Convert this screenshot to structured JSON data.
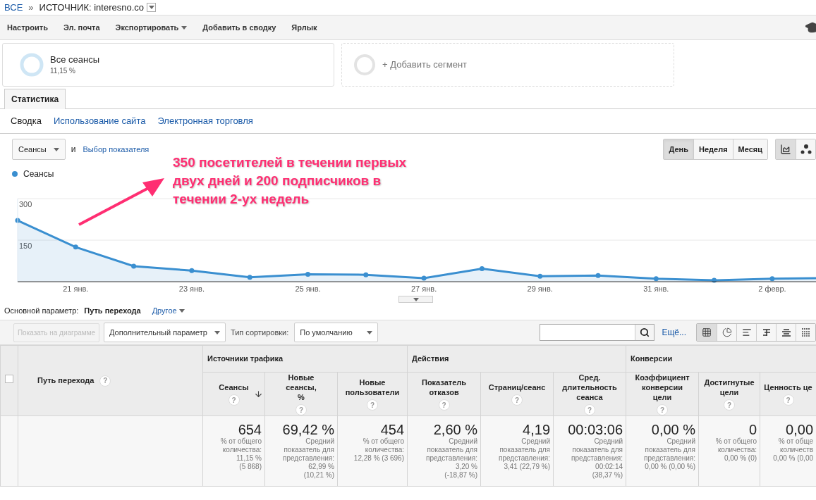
{
  "breadcrumb": {
    "root": "ВСЕ",
    "separator": "»",
    "current": "ИСТОЧНИК: interesno.co"
  },
  "toolbar": [
    "Настроить",
    "Эл. почта",
    "Экспортировать",
    "Добавить в сводку",
    "Ярлык"
  ],
  "segments": [
    {
      "kind": "active",
      "title": "Все сеансы",
      "value": "11,15 %",
      "level": 0.1115
    },
    {
      "kind": "add",
      "title": "+ Добавить сегмент"
    }
  ],
  "tabs": [
    {
      "label": "Статистика",
      "selected": true
    }
  ],
  "subnav": [
    {
      "label": "Сводка",
      "selected": true
    },
    {
      "label": "Использование сайта",
      "selected": false
    },
    {
      "label": "Электронная торговля",
      "selected": false
    }
  ],
  "metric_picker": {
    "value": "Сеансы",
    "conjunction": "и",
    "link": "Выбор показателя"
  },
  "periods": [
    {
      "label": "День",
      "selected": true
    },
    {
      "label": "Неделя",
      "selected": false
    },
    {
      "label": "Месяц",
      "selected": false
    }
  ],
  "chart_types": [
    {
      "kind": "line",
      "selected": true
    },
    {
      "kind": "motion",
      "selected": false
    }
  ],
  "annotation": "350 посетителей в течении первых двух дней и 200 подписчиков в течении 2-ух недель",
  "chart_data": {
    "type": "area",
    "categories": [
      null,
      "21 янв.",
      null,
      "23 янв.",
      null,
      "25 янв.",
      null,
      "27 янв.",
      null,
      "29 янв.",
      null,
      "31 янв.",
      null,
      "2 февр.",
      null
    ],
    "series": [
      {
        "name": "Сеансы",
        "color": "#3a8fd0",
        "values": [
          221,
          125,
          56,
          40,
          16,
          27,
          25,
          13,
          47,
          20,
          22,
          11,
          5,
          11,
          13
        ]
      }
    ],
    "ylim": [
      0,
      300
    ],
    "yticks": [
      {
        "value": 150,
        "label": "150"
      },
      {
        "value": 300,
        "label": "300"
      }
    ]
  },
  "dimension": {
    "label": "Основной параметр:",
    "value": "Путь перехода",
    "other": "Другое"
  },
  "table_toolbar": {
    "plot_button": "Показать на диаграмме",
    "secondary": "Дополнительный параметр",
    "sort_label": "Тип сортировки:",
    "sort_value": "По умолчанию",
    "more": "Ещё..."
  },
  "views": [
    {
      "kind": "table",
      "selected": true
    },
    {
      "kind": "pie",
      "selected": false
    },
    {
      "kind": "bars",
      "selected": false
    },
    {
      "kind": "compare",
      "selected": false
    },
    {
      "kind": "terms",
      "selected": false
    },
    {
      "kind": "pivot",
      "selected": false
    }
  ],
  "table": {
    "select_all_checked": false,
    "dimension_column": {
      "label": "Путь перехода",
      "help": "?"
    },
    "groups": [
      {
        "label": "Источники трафика",
        "columns": [
          {
            "label": "Сеансы",
            "help": "?",
            "sorted": true
          },
          {
            "label": "Новые сеансы, %",
            "help": "?",
            "sorted": false
          },
          {
            "label": "Новые пользователи",
            "help": "?",
            "sorted": false
          }
        ]
      },
      {
        "label": "Действия",
        "columns": [
          {
            "label": "Показатель отказов",
            "help": "?",
            "sorted": false
          },
          {
            "label": "Страниц/сеанс",
            "help": "?",
            "sorted": false
          },
          {
            "label": "Сред. длительность сеанса",
            "help": "?",
            "sorted": false
          }
        ]
      },
      {
        "label": "Конверсии",
        "columns": [
          {
            "label": "Коэффициент конверсии цели",
            "help": "?",
            "sorted": false
          },
          {
            "label": "Достигнутые цели",
            "help": "?",
            "sorted": false
          },
          {
            "label": "Ценность це",
            "help": "?",
            "sorted": false
          }
        ]
      }
    ],
    "totals": [
      {
        "value": "654",
        "note": [
          "% от общего",
          "количества:",
          "11,15 %",
          "(5 868)"
        ]
      },
      {
        "value": "69,42 %",
        "note": [
          "Средний",
          "показатель для",
          "представления:",
          "62,99 %",
          "(10,21 %)"
        ]
      },
      {
        "value": "454",
        "note": [
          "% от общего",
          "количества:",
          "12,28 % (3 696)"
        ]
      },
      {
        "value": "2,60 %",
        "note": [
          "Средний",
          "показатель для",
          "представления:",
          "3,20 %",
          "(-18,87 %)"
        ]
      },
      {
        "value": "4,19",
        "note": [
          "Средний",
          "показатель для",
          "представления:",
          "3,41 (22,79 %)"
        ]
      },
      {
        "value": "00:03:06",
        "note": [
          "Средний",
          "показатель для",
          "представления:",
          "00:02:14",
          "(38,37 %)"
        ]
      },
      {
        "value": "0,00 %",
        "note": [
          "Средний",
          "показатель для",
          "представления:",
          "0,00 % (0,00 %)"
        ]
      },
      {
        "value": "0",
        "note": [
          "% от общего",
          "количества:",
          "0,00 % (0)"
        ]
      },
      {
        "value": "0,00",
        "note": [
          "% от обще",
          "количеств",
          "0,00 % (0,00"
        ]
      }
    ]
  }
}
